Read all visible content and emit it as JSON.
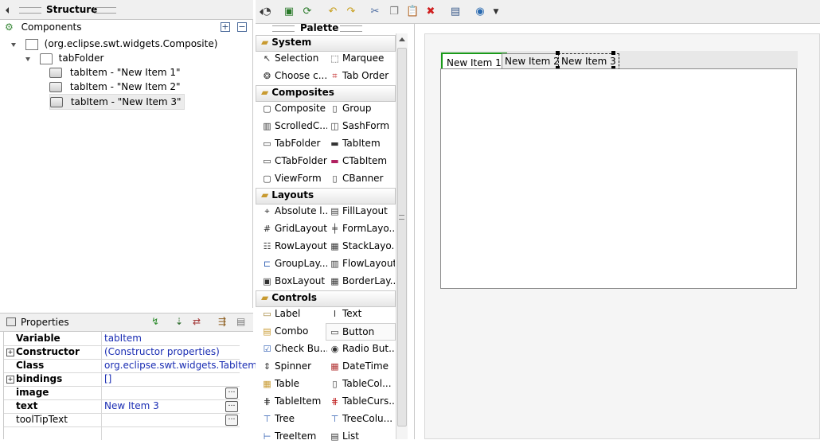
{
  "structure": {
    "title": "Structure",
    "components_label": "Components",
    "tree": [
      {
        "label": "(org.eclipse.swt.widgets.Composite)"
      },
      {
        "label": "tabFolder"
      },
      {
        "label": "tabItem - \"New Item 1\""
      },
      {
        "label": "tabItem - \"New Item 2\""
      },
      {
        "label": "tabItem - \"New Item 3\""
      }
    ]
  },
  "properties": {
    "title": "Properties",
    "rows": [
      {
        "name": "Variable",
        "value": "tabItem"
      },
      {
        "name": "Constructor",
        "value": "(Constructor properties)"
      },
      {
        "name": "Class",
        "value": "org.eclipse.swt.widgets.TabItem"
      },
      {
        "name": "bindings",
        "value": "[]"
      },
      {
        "name": "image",
        "value": ""
      },
      {
        "name": "text",
        "value": "New Item 3"
      },
      {
        "name": "toolTipText",
        "value": ""
      }
    ]
  },
  "palette": {
    "title": "Palette",
    "categories": {
      "system": "System",
      "composites": "Composites",
      "layouts": "Layouts",
      "controls": "Controls"
    },
    "items": {
      "selection": "Selection",
      "marquee": "Marquee",
      "choose": "Choose c...",
      "taborder": "Tab Order",
      "composite": "Composite",
      "group": "Group",
      "scrolled": "ScrolledC...",
      "sashform": "SashForm",
      "tabfolder": "TabFolder",
      "tabitem": "TabItem",
      "ctabfolder": "CTabFolder",
      "ctabitem": "CTabItem",
      "viewform": "ViewForm",
      "cbanner": "CBanner",
      "absolute": "Absolute l...",
      "filllayout": "FillLayout",
      "gridlayout": "GridLayout",
      "formlayout": "FormLayo...",
      "rowlayout": "RowLayout",
      "stacklayout": "StackLayo...",
      "grouplayout": "GroupLay...",
      "flowlayout": "FlowLayout",
      "boxlayout": "BoxLayout",
      "borderlayout": "BorderLay...",
      "label": "Label",
      "text": "Text",
      "combo": "Combo",
      "button": "Button",
      "checkbutton": "Check Bu...",
      "radiobutton": "Radio But...",
      "spinner": "Spinner",
      "datetime": "DateTime",
      "table": "Table",
      "tablecol": "TableCol...",
      "tableitem": "TableItem",
      "tablecurs": "TableCurs...",
      "tree": "Tree",
      "treecol": "TreeColu...",
      "treeitem": "TreeItem",
      "list": "List"
    }
  },
  "design": {
    "tabs": [
      "New Item 1",
      "New Item 2",
      "New Item 3"
    ]
  },
  "colors": {
    "selected_tab_border": "#1a9a1a",
    "value_text": "#1a2db3"
  }
}
